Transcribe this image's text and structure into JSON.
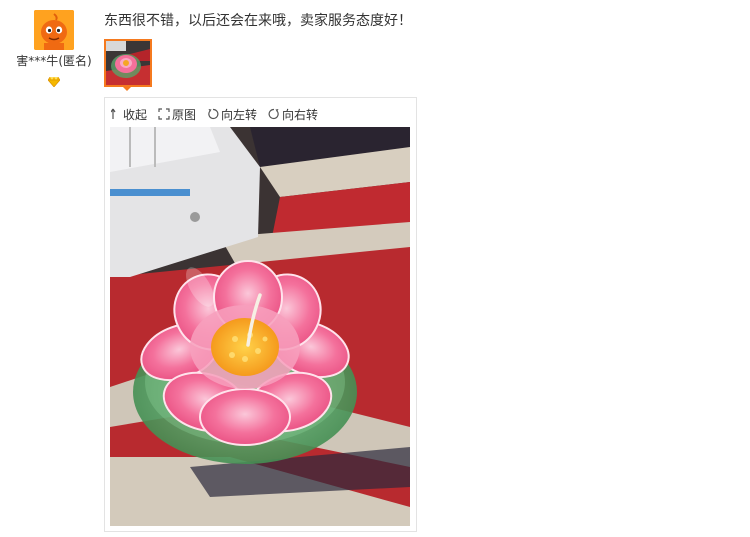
{
  "review": {
    "user": {
      "name": "害***牛",
      "anonymous_label": "(匿名)",
      "avatar_icon": "orange-mascot-avatar",
      "rank_icon": "diamond-icon"
    },
    "text": "东西很不错，以后还会在来哦，卖家服务态度好！",
    "thumbnail_icon": "photo-thumbnail",
    "accent_color": "#f57a1f"
  },
  "viewer": {
    "toolbar": {
      "collapse": "收起",
      "original": "原图",
      "rotate_left": "向左转",
      "rotate_right": "向右转"
    },
    "photo_subject": "pink-lotus-candle-photo"
  }
}
